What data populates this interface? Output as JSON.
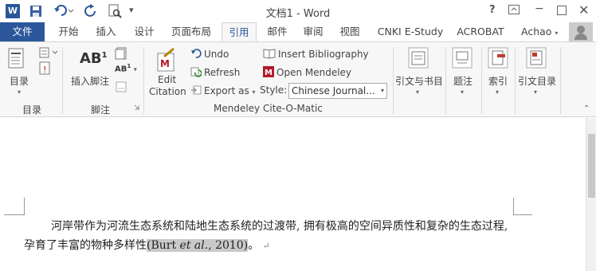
{
  "app": {
    "logo_letter": "W",
    "title": "文档1 - Word"
  },
  "title_bar": {
    "help": "?",
    "minimize": "−",
    "close": "✕"
  },
  "tabs": [
    "文件",
    "开始",
    "插入",
    "设计",
    "页面布局",
    "引用",
    "邮件",
    "审阅",
    "视图",
    "CNKI E-Study",
    "ACROBAT"
  ],
  "active_tab": "引用",
  "account_name": "Achao",
  "ribbon": {
    "toc": {
      "button": "目录",
      "group": "目录"
    },
    "footnotes": {
      "button": "插入脚注",
      "ab_icon": "AB",
      "group": "脚注"
    },
    "mendeley": {
      "edit_citation_line1": "Edit",
      "edit_citation_line2": "Citation",
      "undo": "Undo",
      "refresh": "Refresh",
      "export_as": "Export as",
      "insert_bibliography": "Insert Bibliography",
      "open_mendeley": "Open Mendeley",
      "style_label": "Style:",
      "style_value": "Chinese Journal...",
      "group": "Mendeley Cite-O-Matic"
    },
    "citations": "引文与书目",
    "captions": "题注",
    "index": "索引",
    "authorities": "引文目录"
  },
  "document": {
    "paragraph_text": "河岸带作为河流生态系统和陆地生态系统的过渡带, 拥有极高的空间异质性和复杂的生态过程, 孕育了丰富的物种多样性",
    "citation_open": "(Burt ",
    "citation_etal": "et al.",
    "citation_close": ", 2010)",
    "end_punct": "。",
    "paragraph_mark": "↵"
  },
  "colors": {
    "word_blue": "#2b579a",
    "ribbon_bg": "#f7f7f7",
    "mendeley_red": "#b11a2b",
    "highlight": "#c9c9c9"
  }
}
